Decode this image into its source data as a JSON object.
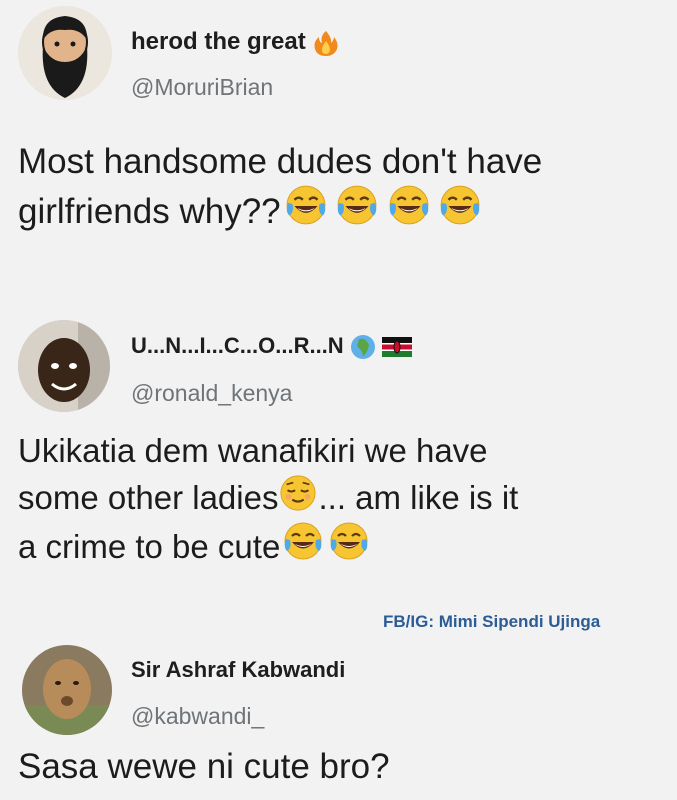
{
  "tweets": [
    {
      "name": "herod the great",
      "handle": "@MoruriBrian",
      "name_icon": "fire-icon",
      "lines": [
        "Most handsome dudes don't have",
        "girlfriends why??"
      ],
      "trailing_emoji": [
        "tears-of-joy-icon",
        "tears-of-joy-icon",
        "tears-of-joy-icon",
        "tears-of-joy-icon"
      ]
    },
    {
      "name": "U...N...I...C...O...R...N",
      "handle": "@ronald_kenya",
      "name_icons": [
        "globe-africa-icon",
        "kenya-flag-icon"
      ],
      "line1": "Ukikatia dem wanafikiri we have",
      "line2a": "some other ladies",
      "line2b": "... am like is it",
      "line3": "a crime to be cute",
      "emojis": [
        "relieved-face-icon",
        "tears-of-joy-icon",
        "tears-of-joy-icon"
      ]
    },
    {
      "name": "Sir Ashraf Kabwandi",
      "handle": "@kabwandi_",
      "lines": [
        "Sasa wewe ni cute bro?"
      ]
    }
  ],
  "credit": "FB/IG: Mimi Sipendi Ujinga",
  "colors": {
    "background": "#f2f2f2",
    "handle": "#6f7479",
    "credit": "#2c5c95"
  }
}
